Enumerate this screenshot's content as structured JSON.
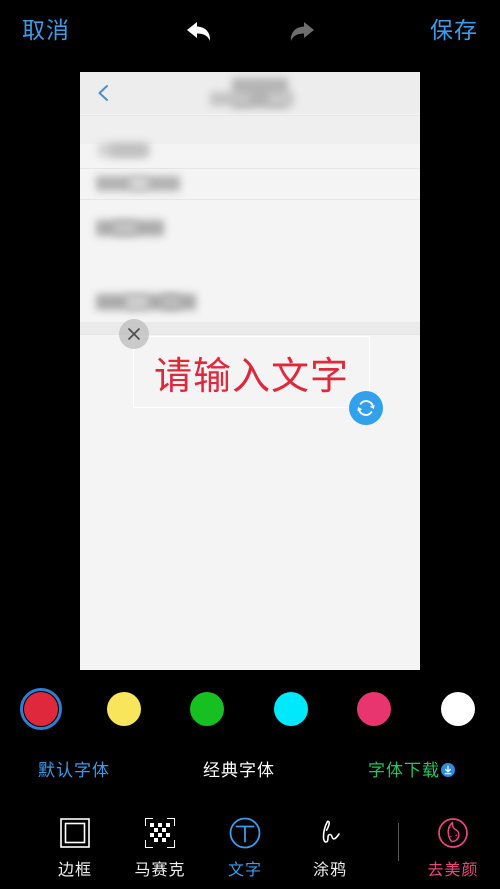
{
  "topbar": {
    "cancel_label": "取消",
    "save_label": "保存",
    "undo_icon": "undo-arrow-icon",
    "redo_icon": "redo-arrow-icon"
  },
  "canvas": {
    "back_icon": "back-chevron-icon",
    "text_overlay": {
      "value": "请输入文字",
      "color": "#E0283C",
      "close_icon": "close-icon",
      "rotate_icon": "rotate-handle-icon"
    }
  },
  "colors": {
    "selected_index": 0,
    "ring_color": "#2E7FD4",
    "swatches": [
      {
        "name": "red",
        "hex": "#E0283C",
        "selected": true
      },
      {
        "name": "yellow",
        "hex": "#F8E55C",
        "selected": false
      },
      {
        "name": "green",
        "hex": "#15C020",
        "selected": false
      },
      {
        "name": "cyan",
        "hex": "#00E8FB",
        "selected": false
      },
      {
        "name": "pink",
        "hex": "#E8356F",
        "selected": false
      },
      {
        "name": "white",
        "hex": "#FFFFFF",
        "selected": false
      }
    ]
  },
  "fonts": {
    "items": [
      {
        "label": "默认字体",
        "color": "#3D9BE9",
        "selected": true,
        "badge": false
      },
      {
        "label": "经典字体",
        "color": "#FFFFFF",
        "selected": false,
        "badge": false
      },
      {
        "label": "字体下载",
        "color": "#22C55E",
        "selected": false,
        "badge": true,
        "badge_icon": "download-icon"
      }
    ]
  },
  "toolbar": {
    "items": [
      {
        "label": "边框",
        "icon": "border-frame-icon",
        "active": false
      },
      {
        "label": "马赛克",
        "icon": "mosaic-icon",
        "active": false
      },
      {
        "label": "文字",
        "icon": "text-circle-t-icon",
        "active": true
      },
      {
        "label": "涂鸦",
        "icon": "doodle-brush-icon",
        "active": false
      },
      {
        "label": "去美颜",
        "icon": "debeautify-face-icon",
        "active": false
      }
    ]
  }
}
